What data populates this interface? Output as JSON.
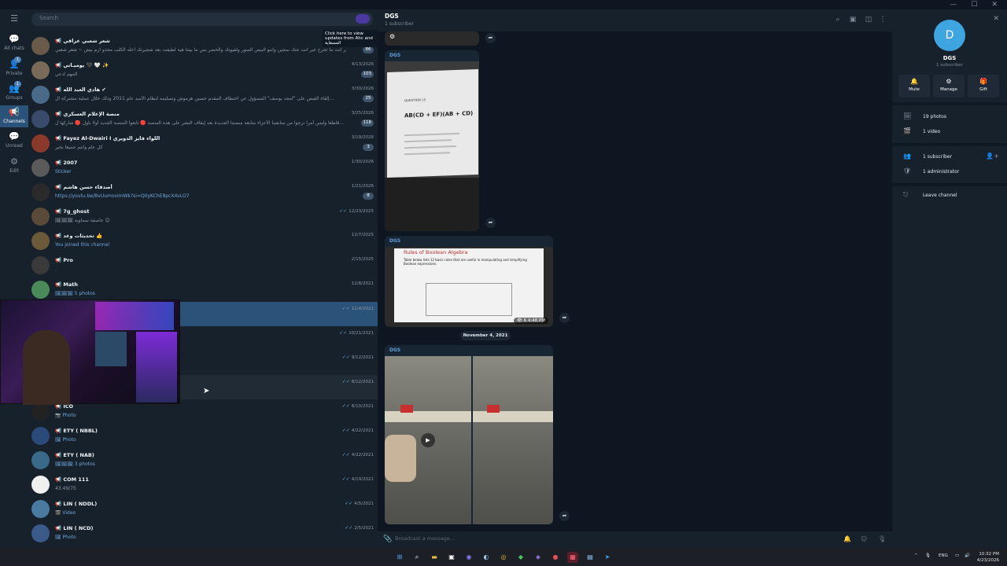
{
  "window": {
    "minimize": "—",
    "maximize": "☐",
    "close": "✕"
  },
  "rail": [
    {
      "label": "All chats",
      "badge": "",
      "icon": "☰"
    },
    {
      "label": "All chats",
      "badge": "",
      "icon": "💬"
    },
    {
      "label": "Private",
      "badge": "1",
      "icon": "👤"
    },
    {
      "label": "Groups",
      "badge": "1",
      "icon": "👥"
    },
    {
      "label": "Channels",
      "badge": "",
      "icon": "📢"
    },
    {
      "label": "Unread",
      "badge": "",
      "icon": "💬"
    },
    {
      "label": "Edit",
      "badge": "",
      "icon": "⚙"
    }
  ],
  "chatlist": {
    "search_placeholder": "Search",
    "tooltip": "Click here to view updates from Ahc and المسقاية",
    "chats": [
      {
        "title": "📢 شعر شعبي عراقي",
        "preview": "غير انت ما تجرح غير انت جنك سجين وانبو البيض الصور ولفيونك والخضر بس ما بيتنا هية لطيفت بعد شجيرتك أعله الكلب محذو ازم بيش ~ شعر شعبي",
        "date": "",
        "badge": "86"
      },
      {
        "title": "📢 يوميـاتي 🖤 🤍 ✨",
        "preview": "المهم ادعي",
        "date": "4/13/2026",
        "badge": "103"
      },
      {
        "title": "📢 هادي العبد الله ✔",
        "preview": "إلقاء القبض على \"أمجد يوسف\" المسؤول عن اختطاف المقدم حسين هرموش وتسليمه لنظام الأسد عام 2011 وذلك خلال عملية مشتركة ال...",
        "date": "3/30/2026",
        "badge": "25"
      },
      {
        "title": "📢 منصة الإعلام العسكري",
        "preview": "قاطعا ولبس أمراً نرجوا من متابعينا الأعزاء متابعة منصتنا الجديدة بعد إيقاف النشر على هذه المنصة 🔴 تابعوا المنصة الجديد أولا بأول 🔴 شاركها ل...",
        "date": "3/25/2026",
        "badge": "118"
      },
      {
        "title": "📢 Fayez Al-Dwairi I اللواء فايز الدويري",
        "preview": "كل عام وانتم جميعا بخير",
        "date": "3/19/2026",
        "badge": "3"
      },
      {
        "title": "📢 2007",
        "preview": "Sticker",
        "date": "1/30/2026",
        "badge": ""
      },
      {
        "title": "📢 أصدقاء حسن هاشم",
        "preview": "https://youtu.be/BvUumovimWk?si=Q0yKChE8pcX4vLO7",
        "date": "1/21/2026",
        "badge": "8"
      },
      {
        "title": "📢 7g_ghost",
        "preview": "🖼🖼🖼 عاصفة سماوية 😊",
        "date": "12/23/2025",
        "badge": ""
      },
      {
        "title": "📢 تحديثات وعد 👍",
        "preview": "You joined this channel",
        "date": "12/7/2025",
        "badge": ""
      },
      {
        "title": "📢 Pro",
        "preview": ".",
        "date": "2/15/2025",
        "badge": ""
      },
      {
        "title": "📢 Math",
        "preview": "🖼🖼🖼 5 photos",
        "date": "12/8/2021",
        "badge": ""
      },
      {
        "title": "📢 DGS",
        "preview": "",
        "date": "11/4/2021",
        "badge": ""
      },
      {
        "title": "",
        "preview": "",
        "date": "10/21/2021",
        "badge": ""
      },
      {
        "title": "",
        "preview": "",
        "date": "9/12/2021",
        "badge": ""
      },
      {
        "title": "",
        "preview": "",
        "date": "8/12/2021",
        "badge": ""
      },
      {
        "title": "📢 ICO",
        "preview": "📷 Photo",
        "date": "8/10/2021",
        "badge": ""
      },
      {
        "title": "📢 ETY ( NBBL)",
        "preview": "🖼 Photo",
        "date": "4/22/2021",
        "badge": ""
      },
      {
        "title": "📢 ETY ( NAB)",
        "preview": "🖼🖼🖼 3 photos",
        "date": "4/22/2021",
        "badge": ""
      },
      {
        "title": "📢 COM 111",
        "preview": "43.49/75",
        "date": "4/19/2021",
        "badge": ""
      },
      {
        "title": "📢 LIN ( NDDL)",
        "preview": "🎬 Video",
        "date": "4/5/2021",
        "badge": ""
      },
      {
        "title": "📢 LIN ( NCD)",
        "preview": "🖼 Photo",
        "date": "2/5/2021",
        "badge": ""
      }
    ]
  },
  "chat": {
    "title": "DGS",
    "subtitle": "1 subscriber",
    "messages": [
      {
        "sender": "DGS",
        "image_title": "QUESTION 15",
        "image_text": "AB(CD + EF)(AB + CD)"
      },
      {
        "sender": "DGS",
        "image_title": "Rules of Boolean Algebra",
        "image_text": "Table below lists 12 basic rules that are useful in manipulating and simplifying Boolean expressions.",
        "views": "6",
        "time": "4:48 PM"
      },
      {
        "sender": "DGS",
        "image_title": "",
        "image_text": ""
      }
    ],
    "date_pill": "November 4, 2021",
    "composer_placeholder": "Broadcast a message..."
  },
  "info": {
    "avatar_letter": "D",
    "name": "DGS",
    "subscribers": "1 subscriber",
    "buttons": [
      {
        "label": "Mute",
        "icon": "🔔"
      },
      {
        "label": "Manage",
        "icon": "⚙"
      },
      {
        "label": "Gift",
        "icon": "🎁"
      }
    ],
    "media": [
      {
        "label": "19 photos",
        "icon": "🖼"
      },
      {
        "label": "1 video",
        "icon": "🎬"
      }
    ],
    "members": [
      {
        "label": "1 subscriber",
        "icon": "👥"
      },
      {
        "label": "1 administrator",
        "icon": "🛡"
      }
    ],
    "leave": {
      "label": "Leave channel",
      "icon": "⎋"
    }
  },
  "taskbar": {
    "lang": "ENG",
    "time": "10:32 PM",
    "date": "4/23/2026"
  }
}
